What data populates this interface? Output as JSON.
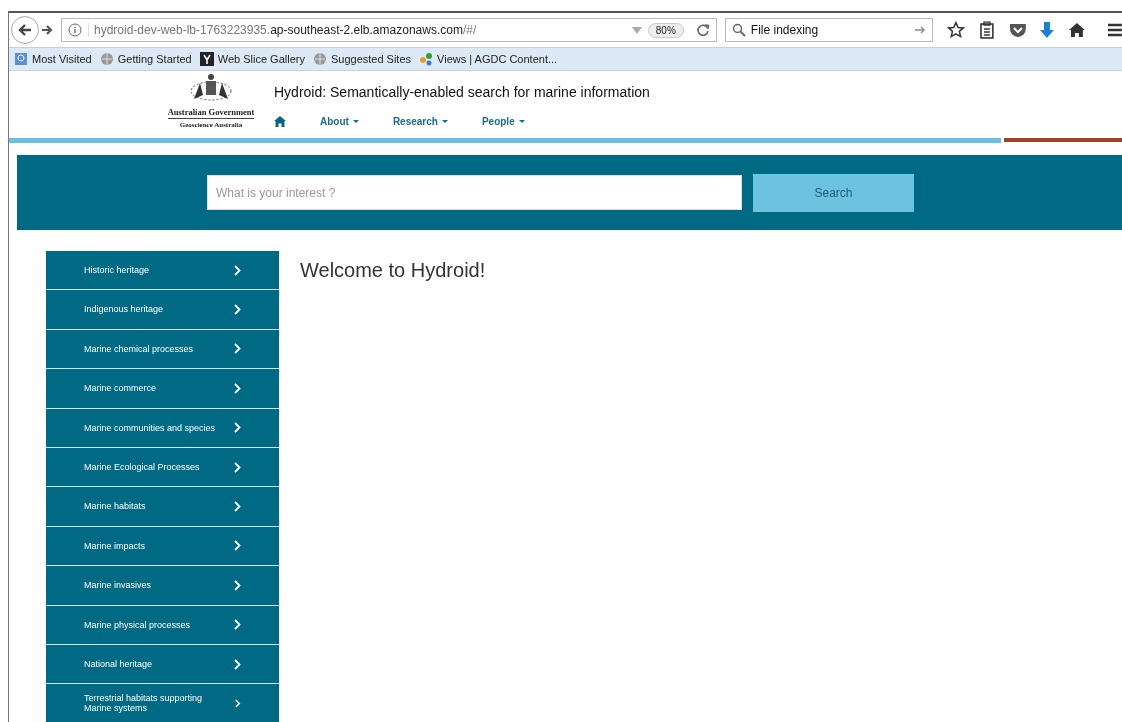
{
  "browser": {
    "url_host_prefix": "hydroid-dev-web-lb-1763223935.",
    "url_domain": "ap-southeast-2.elb.amazonaws.com",
    "url_path": "/#/",
    "zoom": "80%",
    "search_value": "File indexing",
    "bookmarks": [
      {
        "label": "Most Visited",
        "kind": "folder"
      },
      {
        "label": "Getting Started",
        "kind": "globe"
      },
      {
        "label": "Web Slice Gallery",
        "kind": "slice"
      },
      {
        "label": "Suggested Sites",
        "kind": "globe"
      },
      {
        "label": "Views | AGDC Content...",
        "kind": "views"
      }
    ]
  },
  "header": {
    "agency_lines": [
      "Australian Government",
      "Geoscience Australia"
    ],
    "title": "Hydroid: Semantically-enabled search for marine information",
    "nav": [
      {
        "label": "About"
      },
      {
        "label": "Research"
      },
      {
        "label": "People"
      }
    ]
  },
  "search": {
    "placeholder": "What is your interest ?",
    "button": "Search"
  },
  "sidebar": {
    "items": [
      {
        "label": "Historic heritage"
      },
      {
        "label": "Indigenous heritage"
      },
      {
        "label": "Marine chemical processes"
      },
      {
        "label": "Marine commerce"
      },
      {
        "label": "Marine communities and species"
      },
      {
        "label": "Marine Ecological Processes"
      },
      {
        "label": "Marine habitats"
      },
      {
        "label": "Marine impacts"
      },
      {
        "label": "Marine invasives"
      },
      {
        "label": "Marine physical processes"
      },
      {
        "label": "National heritage"
      },
      {
        "label": "Terrestrial habitats supporting Marine systems"
      }
    ]
  },
  "main": {
    "heading": "Welcome to Hydroid!"
  }
}
